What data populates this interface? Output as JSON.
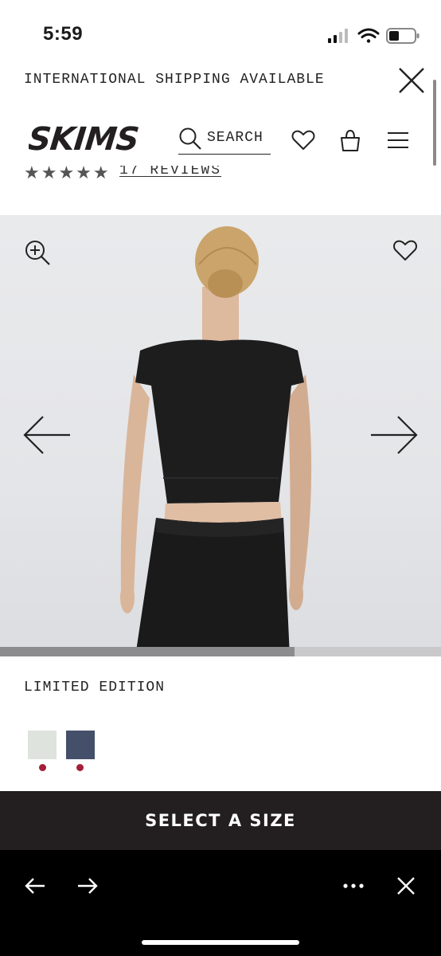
{
  "status_bar": {
    "time": "5:59"
  },
  "banner": {
    "text": "INTERNATIONAL SHIPPING AVAILABLE"
  },
  "header": {
    "brand": "SKIMS",
    "search_label": "SEARCH"
  },
  "reviews": {
    "stars": "★★★★★",
    "text": "17 REVIEWS"
  },
  "product": {
    "edition_label": "LIMITED EDITION",
    "swatches": [
      {
        "color": "#dfe3dd"
      },
      {
        "color": "#44506a"
      }
    ]
  },
  "cta": {
    "label": "SELECT A SIZE"
  },
  "colors": {
    "accent_dot": "#a31f3a",
    "cta_background": "#231f20"
  }
}
